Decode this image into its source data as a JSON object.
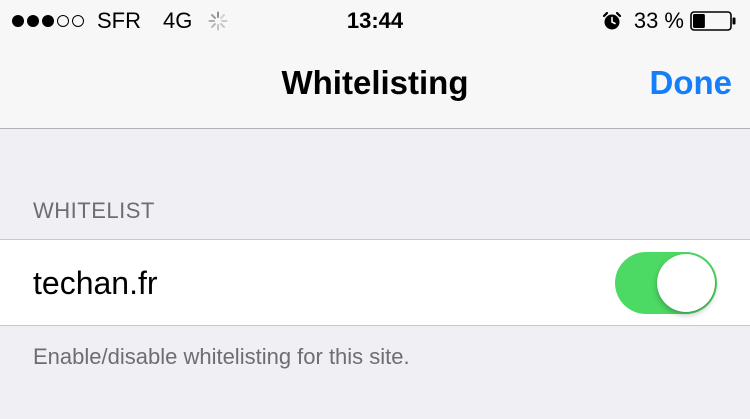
{
  "status_bar": {
    "signal_bars_filled": 3,
    "signal_bars_total": 5,
    "carrier": "SFR",
    "network": "4G",
    "time": "13:44",
    "battery_percent": "33 %",
    "battery_level": 0.33,
    "icons": [
      "signal-icon",
      "activity-spinner-icon",
      "alarm-icon",
      "battery-icon"
    ]
  },
  "nav": {
    "title": "Whitelisting",
    "done_label": "Done",
    "accent_color": "#157efb"
  },
  "section": {
    "header": "WHITELIST",
    "cell": {
      "label": "techan.fr",
      "toggle_on": true,
      "toggle_color": "#4cd964"
    },
    "footer": "Enable/disable whitelisting for this site."
  }
}
